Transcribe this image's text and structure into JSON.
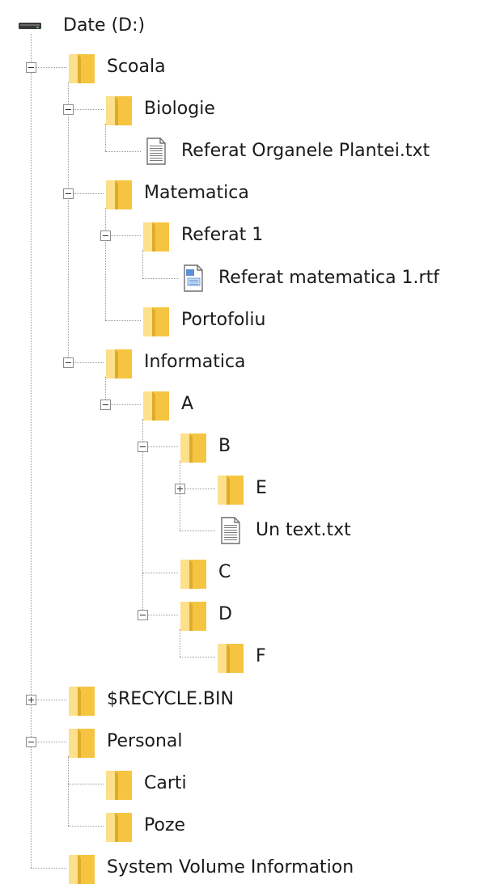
{
  "tree": {
    "drive": {
      "label": "Date (D:)",
      "icon": "drive-icon"
    },
    "items": [
      {
        "label": "Scoala",
        "icon": "folder-icon",
        "level": 0,
        "toggle": "minus"
      },
      {
        "label": "Biologie",
        "icon": "folder-icon",
        "level": 1,
        "toggle": "minus"
      },
      {
        "label": "Referat Organele Plantei.txt",
        "icon": "text-file-icon",
        "level": 2,
        "toggle": null
      },
      {
        "label": "Matematica",
        "icon": "folder-icon",
        "level": 1,
        "toggle": "minus"
      },
      {
        "label": "Referat 1",
        "icon": "folder-icon",
        "level": 2,
        "toggle": "minus"
      },
      {
        "label": "Referat matematica 1.rtf",
        "icon": "rtf-file-icon",
        "level": 3,
        "toggle": null
      },
      {
        "label": "Portofoliu",
        "icon": "folder-icon",
        "level": 2,
        "toggle": null
      },
      {
        "label": "Informatica",
        "icon": "folder-icon",
        "level": 1,
        "toggle": "minus"
      },
      {
        "label": "A",
        "icon": "folder-icon",
        "level": 2,
        "toggle": "minus"
      },
      {
        "label": "B",
        "icon": "folder-icon",
        "level": 3,
        "toggle": "minus"
      },
      {
        "label": "E",
        "icon": "folder-icon",
        "level": 4,
        "toggle": "plus"
      },
      {
        "label": "Un text.txt",
        "icon": "text-file-icon",
        "level": 4,
        "toggle": null
      },
      {
        "label": "C",
        "icon": "folder-icon",
        "level": 3,
        "toggle": null
      },
      {
        "label": "D",
        "icon": "folder-icon",
        "level": 3,
        "toggle": "minus"
      },
      {
        "label": "F",
        "icon": "folder-icon",
        "level": 4,
        "toggle": null
      },
      {
        "label": "$RECYCLE.BIN",
        "icon": "folder-icon",
        "level": 0,
        "toggle": "plus"
      },
      {
        "label": "Personal",
        "icon": "folder-icon",
        "level": 0,
        "toggle": "minus"
      },
      {
        "label": "Carti",
        "icon": "folder-icon",
        "level": 1,
        "toggle": null
      },
      {
        "label": "Poze",
        "icon": "folder-icon",
        "level": 1,
        "toggle": null
      },
      {
        "label": "System Volume Information",
        "icon": "folder-icon",
        "level": 0,
        "toggle": null
      }
    ]
  },
  "colors": {
    "folder": "#f5c542",
    "folder_light": "#fde08b",
    "connector": "#9a9a9a",
    "text": "#1a1a1a"
  }
}
